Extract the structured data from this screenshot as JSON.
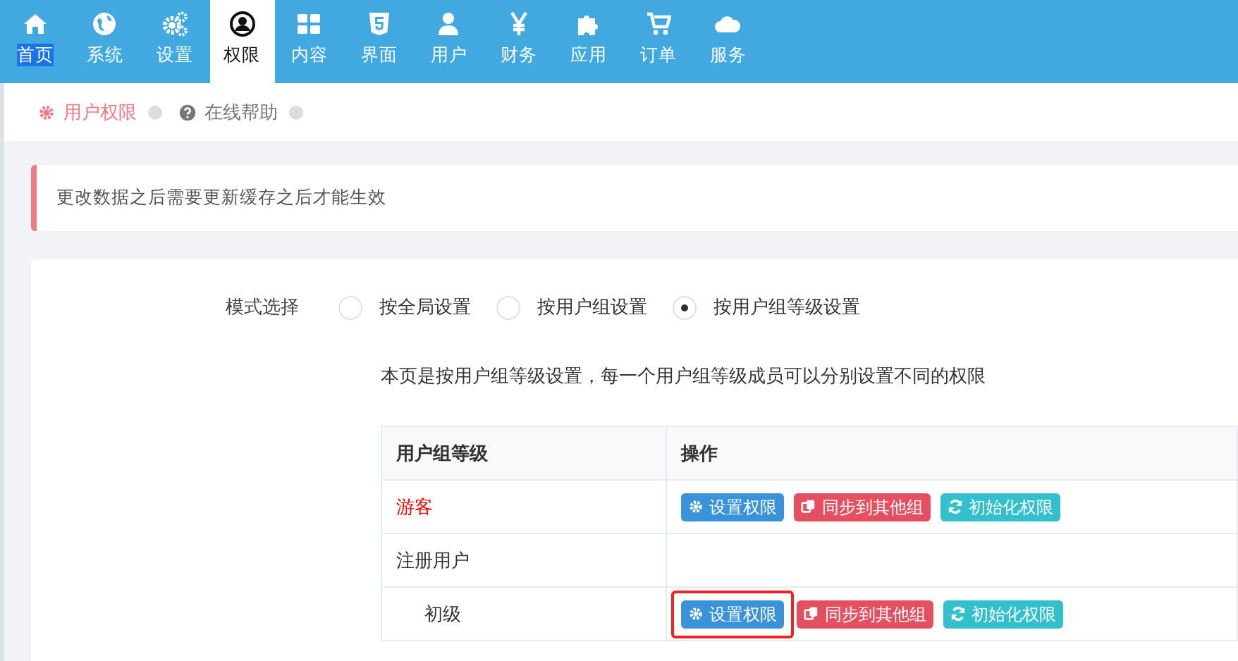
{
  "nav": {
    "items": [
      {
        "label": "首页",
        "selected": false,
        "text_selected": true
      },
      {
        "label": "系统",
        "selected": false,
        "text_selected": false
      },
      {
        "label": "设置",
        "selected": false,
        "text_selected": false
      },
      {
        "label": "权限",
        "selected": true,
        "text_selected": false
      },
      {
        "label": "内容",
        "selected": false,
        "text_selected": false
      },
      {
        "label": "界面",
        "selected": false,
        "text_selected": false
      },
      {
        "label": "用户",
        "selected": false,
        "text_selected": false
      },
      {
        "label": "财务",
        "selected": false,
        "text_selected": false
      },
      {
        "label": "应用",
        "selected": false,
        "text_selected": false
      },
      {
        "label": "订单",
        "selected": false,
        "text_selected": false
      },
      {
        "label": "服务",
        "selected": false,
        "text_selected": false
      }
    ]
  },
  "breadcrumb": [
    {
      "label": "用户权限",
      "selected": true
    },
    {
      "label": "在线帮助",
      "selected": false
    }
  ],
  "alert": {
    "text": "更改数据之后需要更新缓存之后才能生效"
  },
  "mode": {
    "label": "模式选择",
    "options": [
      {
        "label": "按全局设置",
        "selected": false
      },
      {
        "label": "按用户组设置",
        "selected": false
      },
      {
        "label": "按用户组等级设置",
        "selected": true
      }
    ]
  },
  "description": "本页是按用户组等级设置，每一个用户组等级成员可以分别设置不同的权限",
  "table": {
    "columns": [
      "用户组等级",
      "操作"
    ],
    "rows": [
      {
        "name": "游客",
        "color": "#ff0000",
        "outlined": false,
        "actions": [
          {
            "label": "设置权限",
            "kind": "primary"
          },
          {
            "label": "同步到其他组",
            "kind": "danger"
          },
          {
            "label": "初始化权限",
            "kind": "info"
          }
        ]
      },
      {
        "name": "注册用户",
        "color": "#333333",
        "children": [
          {
            "name": "初级",
            "color": "#333333",
            "outlined": true,
            "actions": [
              {
                "label": "设置权限",
                "kind": "primary"
              },
              {
                "label": "同步到其他组",
                "kind": "danger"
              },
              {
                "label": "初始化权限",
                "kind": "info"
              }
            ]
          }
        ]
      }
    ]
  }
}
